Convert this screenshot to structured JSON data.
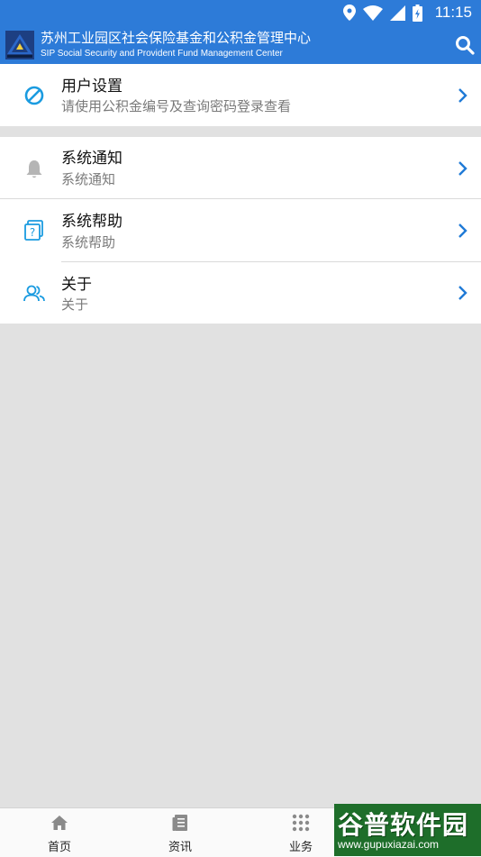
{
  "status_bar": {
    "time": "11:15"
  },
  "app_bar": {
    "title": "苏州工业园区社会保险基金和公积金管理中心",
    "subtitle": "SIP Social Security and Provident Fund Management Center"
  },
  "menu": {
    "user_settings": {
      "title": "用户设置",
      "subtitle": "请使用公积金编号及查询密码登录查看"
    },
    "notifications": {
      "title": "系统通知",
      "subtitle": "系统通知"
    },
    "help": {
      "title": "系统帮助",
      "subtitle": "系统帮助"
    },
    "about": {
      "title": "关于",
      "subtitle": "关于"
    }
  },
  "bottom_nav": {
    "home": "首页",
    "news": "资讯",
    "business": "业务"
  },
  "watermark": {
    "brand": "谷普软件园",
    "url": "www.gupuxiazai.com"
  },
  "colors": {
    "primary": "#2d7bd8",
    "background": "#e1e1e1",
    "accent_icon": "#1a9be0"
  }
}
